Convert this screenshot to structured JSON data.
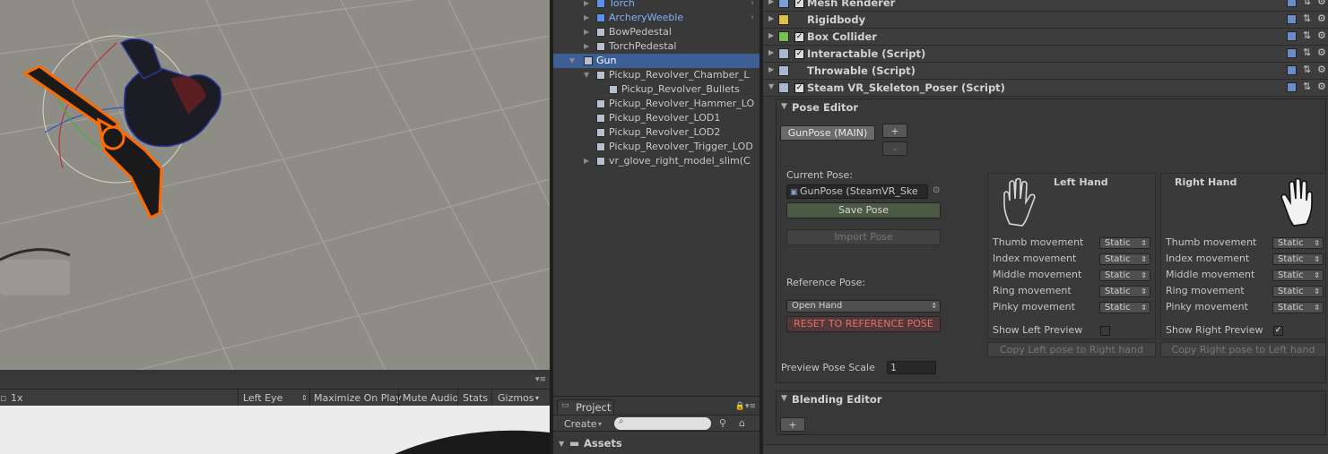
{
  "game_toolbar": {
    "scale": "1x",
    "display": "Left Eye",
    "maximize": "Maximize On Play",
    "mute": "Mute Audio",
    "stats": "Stats",
    "gizmos": "Gizmos"
  },
  "hierarchy": {
    "items": [
      {
        "label": "Torch",
        "prefab": true
      },
      {
        "label": "ArcheryWeeble",
        "prefab": true
      },
      {
        "label": "BowPedestal"
      },
      {
        "label": "TorchPedestal"
      },
      {
        "label": "Gun",
        "selected": true
      },
      {
        "label": "Pickup_Revolver_Chamber_L"
      },
      {
        "label": "Pickup_Revolver_Bullets"
      },
      {
        "label": "Pickup_Revolver_Hammer_LO"
      },
      {
        "label": "Pickup_Revolver_LOD1"
      },
      {
        "label": "Pickup_Revolver_LOD2"
      },
      {
        "label": "Pickup_Revolver_Trigger_LOD"
      },
      {
        "label": "vr_glove_right_model_slim(C"
      }
    ]
  },
  "project": {
    "tab": "Project",
    "create": "Create",
    "assets": "Assets"
  },
  "inspector": {
    "components": [
      {
        "name": "Mesh Renderer",
        "checkbox": true
      },
      {
        "name": "Rigidbody",
        "checkbox": false
      },
      {
        "name": "Box Collider",
        "checkbox": true
      },
      {
        "name": "Interactable (Script)",
        "checkbox": true
      },
      {
        "name": "Throwable (Script)",
        "checkbox": false
      },
      {
        "name": "Steam VR_Skeleton_Poser (Script)",
        "checkbox": true
      }
    ],
    "pose_editor": {
      "title": "Pose Editor",
      "pose_tab": "GunPose (MAIN)",
      "add": "+",
      "remove": "-",
      "current_pose_label": "Current Pose:",
      "current_pose_value": "GunPose (SteamVR_Ske",
      "save_pose": "Save Pose",
      "import_pose": "Import Pose",
      "reference_pose_label": "Reference Pose:",
      "reference_pose_value": "Open Hand",
      "reset_button": "RESET TO REFERENCE POSE",
      "left_hand": {
        "title": "Left Hand",
        "movements": [
          {
            "label": "Thumb movement",
            "value": "Static"
          },
          {
            "label": "Index movement",
            "value": "Static"
          },
          {
            "label": "Middle movement",
            "value": "Static"
          },
          {
            "label": "Ring movement",
            "value": "Static"
          },
          {
            "label": "Pinky movement",
            "value": "Static"
          }
        ],
        "preview_label": "Show Left Preview",
        "preview_checked": false,
        "copy_button": "Copy Left pose to Right hand"
      },
      "right_hand": {
        "title": "Right Hand",
        "movements": [
          {
            "label": "Thumb movement",
            "value": "Static"
          },
          {
            "label": "Index movement",
            "value": "Static"
          },
          {
            "label": "Middle movement",
            "value": "Static"
          },
          {
            "label": "Ring movement",
            "value": "Static"
          },
          {
            "label": "Pinky movement",
            "value": "Static"
          }
        ],
        "preview_label": "Show Right Preview",
        "preview_checked": true,
        "copy_button": "Copy Right pose to Left hand"
      },
      "preview_scale_label": "Preview Pose Scale",
      "preview_scale_value": "1"
    },
    "blending_editor": {
      "title": "Blending Editor",
      "add": "+"
    }
  },
  "colors": {
    "selection": "#3e5f96",
    "prefab_text": "#7fb2ff",
    "reset_red": "#e07070",
    "outline_orange": "#ff6a00"
  }
}
